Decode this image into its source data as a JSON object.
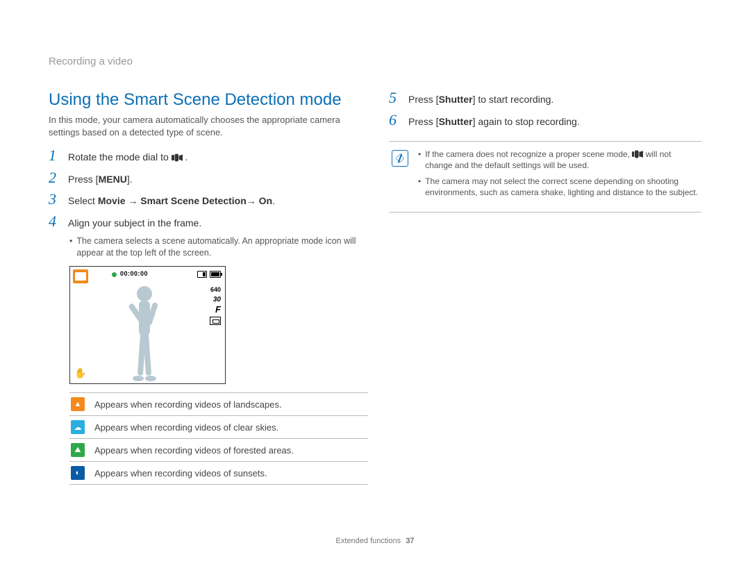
{
  "breadcrumb": "Recording a video",
  "section_title": "Using the Smart Scene Detection mode",
  "intro": "In this mode, your camera automatically chooses the appropriate camera settings based on a detected type of scene.",
  "left_steps": {
    "s1": {
      "num": "1",
      "text_before": "Rotate the mode dial to ",
      "text_after": "."
    },
    "s2": {
      "num": "2",
      "text_before": "Press [",
      "bold": "MENU",
      "text_after": "]."
    },
    "s3": {
      "num": "3",
      "prefix": "Select ",
      "b1": "Movie",
      "arrow1": " → ",
      "b2": "Smart Scene Detection",
      "arrow2": "→ ",
      "b3": "On",
      "suffix": "."
    },
    "s4": {
      "num": "4",
      "text": "Align your subject in the frame."
    },
    "s4_bullet": "The camera selects a scene automatically. An appropriate mode icon will appear at the top left of the screen."
  },
  "preview": {
    "time": "00:00:00",
    "res": "640",
    "fps": "30",
    "f": "F"
  },
  "scene_table": [
    {
      "kind": "landscape",
      "glyph": "▲",
      "desc": "Appears when recording videos of landscapes."
    },
    {
      "kind": "sky",
      "glyph": "☁",
      "desc": "Appears when recording videos of clear skies."
    },
    {
      "kind": "forest",
      "glyph": "⛰",
      "desc": "Appears when recording videos of forested areas."
    },
    {
      "kind": "sunset",
      "glyph": "◐",
      "desc": "Appears when recording videos of sunsets."
    }
  ],
  "right_steps": {
    "s5": {
      "num": "5",
      "pre": "Press [",
      "bold": "Shutter",
      "post": "] to start recording."
    },
    "s6": {
      "num": "6",
      "pre": "Press [",
      "bold": "Shutter",
      "post": "] again to stop recording."
    }
  },
  "notes": {
    "n1_pre": "If the camera does not recognize a proper scene mode, ",
    "n1_post": " will not change and the default settings will be used.",
    "n2": "The camera may not select the correct scene depending on shooting environments, such as camera shake, lighting and distance to the subject."
  },
  "footer": {
    "section": "Extended functions",
    "page": "37"
  }
}
